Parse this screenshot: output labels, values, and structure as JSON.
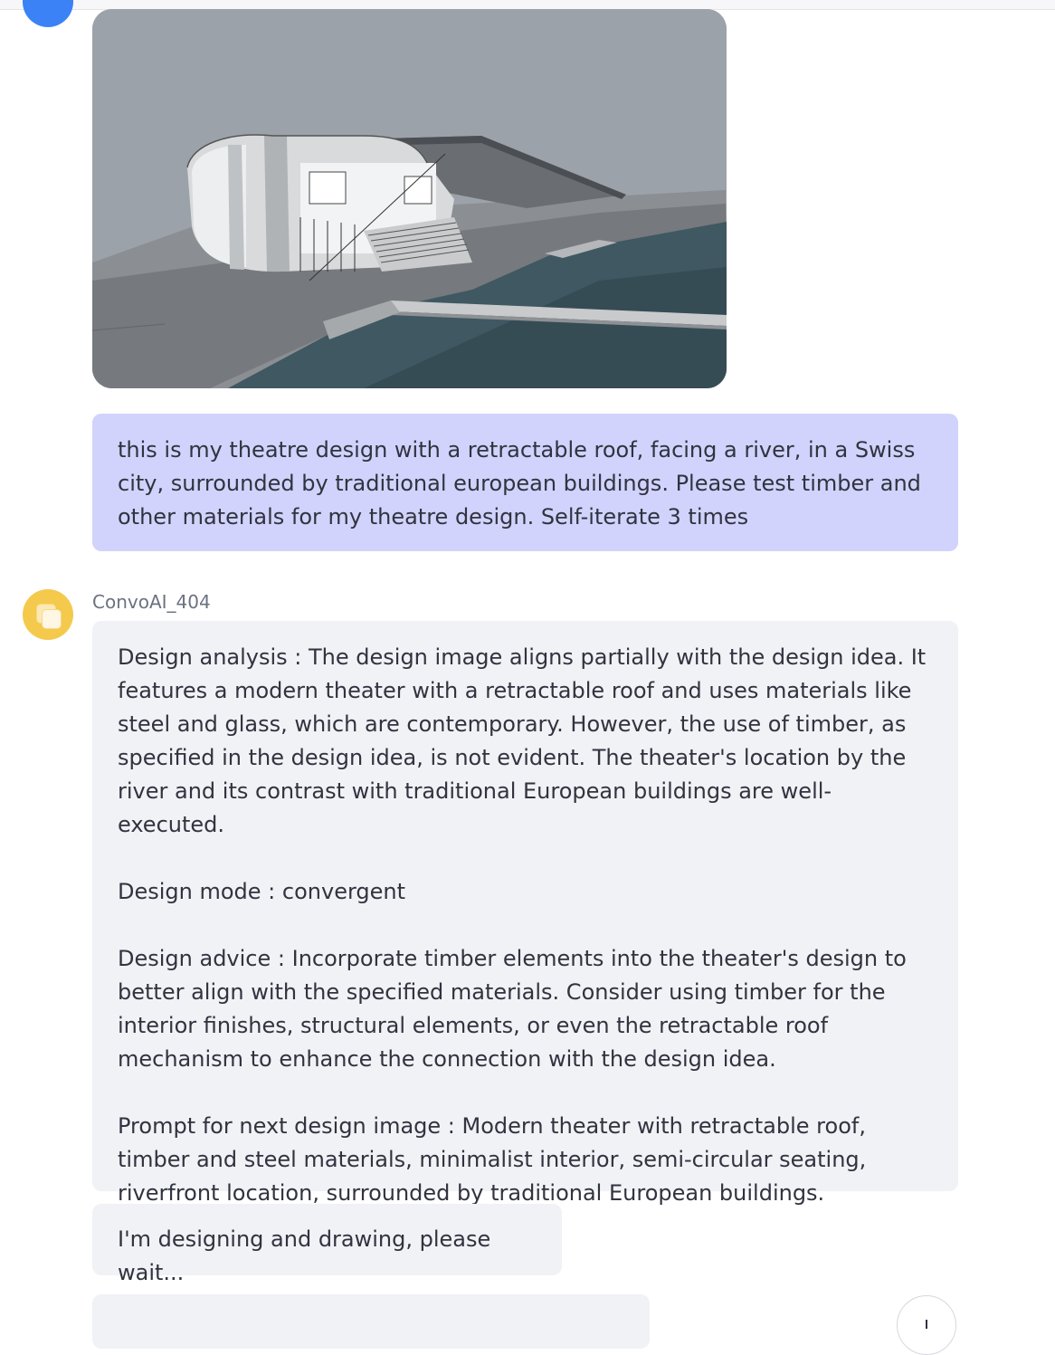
{
  "user_message": {
    "text": "this is my theatre design with a retractable roof, facing a river, in a Swiss city, surrounded by traditional european buildings. Please test timber and other materials for my theatre design. Self-iterate 3 times"
  },
  "assistant": {
    "name": "ConvoAI_404",
    "paragraphs": [
      "Design analysis : The design image aligns partially with the design idea. It features a modern theater with a retractable roof and uses materials like steel and glass, which are contemporary. However, the use of timber, as specified in the design idea, is not evident. The theater's location by the river and its contrast with traditional European buildings are well-executed.",
      "Design mode : convergent",
      "Design advice : Incorporate timber elements into the theater's design to better align with the specified materials. Consider using timber for the interior finishes, structural elements, or even the retractable roof mechanism to enhance the connection with the design idea.",
      "Prompt for next design image : Modern theater with retractable roof, timber and steel materials, minimalist interior, semi-circular seating, riverfront location, surrounded by traditional European buildings."
    ],
    "status": "I'm designing and drawing, please wait..."
  },
  "icons": {
    "user_avatar": "user-avatar-icon",
    "assistant_avatar": "assistant-avatar-icon",
    "scroll_down": "arrow-down-icon"
  },
  "colors": {
    "user_bubble": "#d1d3fc",
    "assistant_bubble": "#f0f2f6",
    "user_avatar": "#3b82f6",
    "assistant_avatar": "#f4c94c"
  }
}
